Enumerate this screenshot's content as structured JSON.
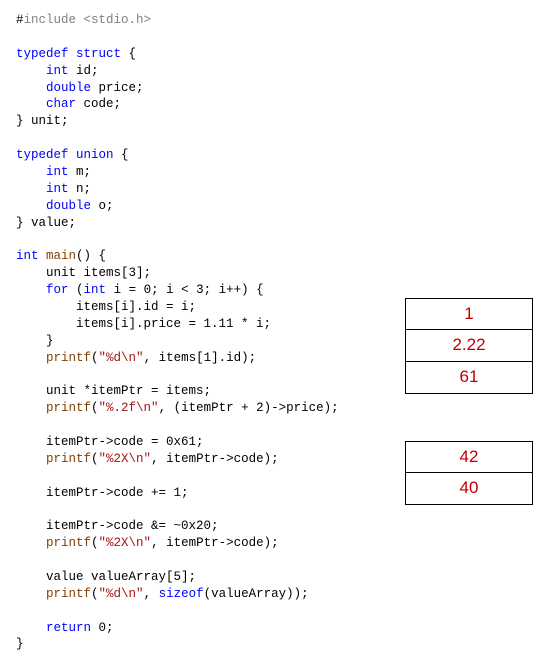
{
  "code": {
    "l1a": "#",
    "l1b": "include ",
    "l1c": "<stdio.h>",
    "l3a": "typedef",
    "l3b": " ",
    "l3c": "struct",
    "l3d": " {",
    "l4a": "    ",
    "l4b": "int",
    "l4c": " id;",
    "l5a": "    ",
    "l5b": "double",
    "l5c": " price;",
    "l6a": "    ",
    "l6b": "char",
    "l6c": " code;",
    "l7": "} unit;",
    "l9a": "typedef",
    "l9b": " ",
    "l9c": "union",
    "l9d": " {",
    "l10a": "    ",
    "l10b": "int",
    "l10c": " m;",
    "l11a": "    ",
    "l11b": "int",
    "l11c": " n;",
    "l12a": "    ",
    "l12b": "double",
    "l12c": " o;",
    "l13": "} value;",
    "l15a": "int",
    "l15b": " ",
    "l15c": "main",
    "l15d": "() {",
    "l16": "    unit items[3];",
    "l17a": "    ",
    "l17b": "for",
    "l17c": " (",
    "l17d": "int",
    "l17e": " i = 0; i < 3; i++) {",
    "l18": "        items[i].id = i;",
    "l19": "        items[i].price = 1.11 * i;",
    "l20": "    }",
    "l21a": "    ",
    "l21b": "printf",
    "l21c": "(",
    "l21d": "\"%d\\n\"",
    "l21e": ", items[1].id);",
    "l23": "    unit *itemPtr = items;",
    "l24a": "    ",
    "l24b": "printf",
    "l24c": "(",
    "l24d": "\"%.2f\\n\"",
    "l24e": ", (itemPtr + 2)->price);",
    "l26": "    itemPtr->code = 0x61;",
    "l27a": "    ",
    "l27b": "printf",
    "l27c": "(",
    "l27d": "\"%2X\\n\"",
    "l27e": ", itemPtr->code);",
    "l29": "    itemPtr->code += 1;",
    "l31": "    itemPtr->code &= ~0x20;",
    "l32a": "    ",
    "l32b": "printf",
    "l32c": "(",
    "l32d": "\"%2X\\n\"",
    "l32e": ", itemPtr->code);",
    "l34": "    value valueArray[5];",
    "l35a": "    ",
    "l35b": "printf",
    "l35c": "(",
    "l35d": "\"%d\\n\"",
    "l35e": ", ",
    "l35f": "sizeof",
    "l35g": "(valueArray));",
    "l37a": "    ",
    "l37b": "return",
    "l37c": " 0;",
    "l38": "}"
  },
  "outputs": {
    "o1": "1",
    "o2": "2.22",
    "o3": "61",
    "o4": "42",
    "o5": "40"
  }
}
